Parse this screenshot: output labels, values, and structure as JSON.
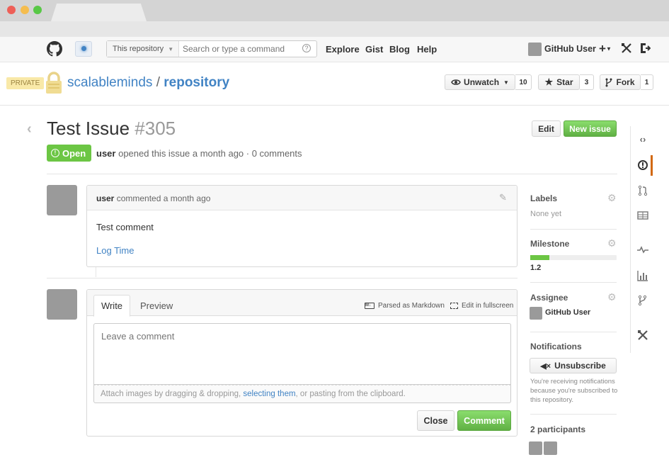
{
  "header": {
    "search_scope": "This repository",
    "search_placeholder": "Search or type a command",
    "nav": [
      "Explore",
      "Gist",
      "Blog",
      "Help"
    ],
    "user_name": "GitHub User"
  },
  "repo": {
    "badge": "PRIVATE",
    "owner": "scalableminds",
    "separator": "/",
    "name": "repository",
    "unwatch_label": "Unwatch",
    "watch_count": "10",
    "star_label": "Star",
    "star_count": "3",
    "fork_label": "Fork",
    "fork_count": "1"
  },
  "issue": {
    "title": "Test Issue",
    "number": "#305",
    "state": "Open",
    "author": "user",
    "meta": "opened this issue a month ago · 0 comments",
    "edit_label": "Edit",
    "new_issue_label": "New issue"
  },
  "comment": {
    "author": "user",
    "meta": "commented a month ago",
    "body": "Test comment",
    "link": "Log Time"
  },
  "composer": {
    "tab_write": "Write",
    "tab_preview": "Preview",
    "markdown_note": "Parsed as Markdown",
    "fullscreen_note": "Edit in fullscreen",
    "placeholder": "Leave a comment",
    "attach_prefix": "Attach images by dragging & dropping,",
    "attach_link": "selecting them",
    "attach_suffix": ", or pasting from the clipboard.",
    "close_label": "Close",
    "comment_label": "Comment"
  },
  "sidebar": {
    "labels_title": "Labels",
    "labels_value": "None yet",
    "milestone_title": "Milestone",
    "milestone_progress": 0.22,
    "milestone_value": "1.2",
    "assignee_title": "Assignee",
    "assignee_name": "GitHub User",
    "notifications_title": "Notifications",
    "unsubscribe_label": "Unsubscribe",
    "notifications_note": "You're receiving notifications because you're subscribed to this repository.",
    "participants_title": "2 participants"
  },
  "colors": {
    "accent_blue": "#4183c4",
    "open_green": "#6cc644",
    "active_tab": "#d26911"
  }
}
